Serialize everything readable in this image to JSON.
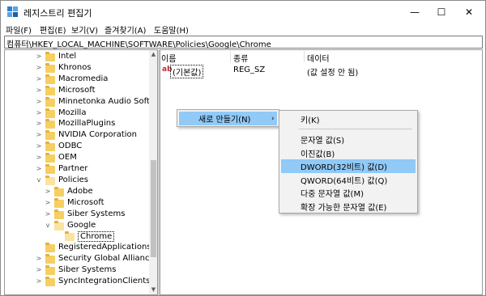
{
  "window": {
    "title": "레지스트리 편집기",
    "minimize_glyph": "—",
    "maximize_glyph": "☐",
    "close_glyph": "✕"
  },
  "menubar": [
    "파일(F)",
    "편집(E)",
    "보기(V)",
    "즐겨찾기(A)",
    "도움말(H)"
  ],
  "address": "컴퓨터\\HKEY_LOCAL_MACHINE\\SOFTWARE\\Policies\\Google\\Chrome",
  "tree": {
    "items": [
      {
        "label": "Intel",
        "level": 1,
        "expander": ">"
      },
      {
        "label": "Khronos",
        "level": 1,
        "expander": ">"
      },
      {
        "label": "Macromedia",
        "level": 1,
        "expander": ">"
      },
      {
        "label": "Microsoft",
        "level": 1,
        "expander": ">"
      },
      {
        "label": "Minnetonka Audio Softwa",
        "level": 1,
        "expander": ">"
      },
      {
        "label": "Mozilla",
        "level": 1,
        "expander": ">"
      },
      {
        "label": "MozillaPlugins",
        "level": 1,
        "expander": ">"
      },
      {
        "label": "NVIDIA Corporation",
        "level": 1,
        "expander": ">"
      },
      {
        "label": "ODBC",
        "level": 1,
        "expander": ">"
      },
      {
        "label": "OEM",
        "level": 1,
        "expander": ">"
      },
      {
        "label": "Partner",
        "level": 1,
        "expander": ">"
      },
      {
        "label": "Policies",
        "level": 1,
        "expander": "v"
      },
      {
        "label": "Adobe",
        "level": 2,
        "expander": ">"
      },
      {
        "label": "Microsoft",
        "level": 2,
        "expander": ">"
      },
      {
        "label": "Siber Systems",
        "level": 2,
        "expander": ">"
      },
      {
        "label": "Google",
        "level": 2,
        "expander": "v"
      },
      {
        "label": "Chrome",
        "level": 3,
        "expander": ""
      },
      {
        "label": "RegisteredApplications",
        "level": 1,
        "expander": ""
      },
      {
        "label": "Security Global Alliance",
        "level": 1,
        "expander": ">"
      },
      {
        "label": "Siber Systems",
        "level": 1,
        "expander": ">"
      },
      {
        "label": "SyncIntegrationClients",
        "level": 1,
        "expander": ">"
      }
    ]
  },
  "list": {
    "headers": {
      "name": "이름",
      "type": "종류",
      "data": "데이터"
    },
    "rows": [
      {
        "icon": "ab",
        "name": "(기본값)",
        "type": "REG_SZ",
        "data": "(값 설정 안 됨)"
      }
    ]
  },
  "context_menu": {
    "new_label": "새로 만들기(N)",
    "arrow": "›"
  },
  "submenu": {
    "items": [
      "키(K)",
      "문자열 값(S)",
      "이진값(B)",
      "DWORD(32비트) 값(D)",
      "QWORD(64비트) 값(Q)",
      "다중 문자열 값(M)",
      "확장 가능한 문자열 값(E)"
    ],
    "highlighted_index": 3
  },
  "colors": {
    "highlight": "#91c9f7",
    "folder": "#f6cf62"
  }
}
